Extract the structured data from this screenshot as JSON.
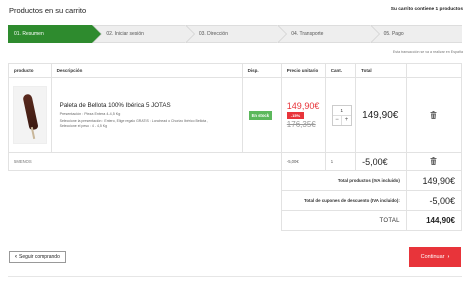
{
  "header": {
    "title": "Productos en su carrito",
    "cart_count": "Su carrito contiene 1 productos"
  },
  "steps": [
    {
      "label": "01. Resumen",
      "active": true
    },
    {
      "label": "02. Iniciar sesión",
      "active": false
    },
    {
      "label": "03. Dirección",
      "active": false
    },
    {
      "label": "04. Transporte",
      "active": false
    },
    {
      "label": "05. Pago",
      "active": false
    }
  ],
  "notice": "Esta transacción se va a realizar en España",
  "table": {
    "headers": {
      "product": "producto",
      "description": "Descripción",
      "availability": "Disp.",
      "unit_price": "Precio unitario",
      "quantity": "Cant.",
      "total": "Total"
    },
    "product": {
      "name": "Paleta de Bellota 100% Ibérica 5 JOTAS",
      "presentation": "Presentación : Pieza Entera 4-4,5 Kg",
      "selection": "Seleccione la presentación : Entero, Elige regalo GRATIS : Lonchead o Chorizo Ibérico Bellota , Seleccione el peso : 4 - 4,5 Kg",
      "stock": "En stock",
      "price": "149,90€",
      "discount": "-15%",
      "old_price": "176,35€",
      "quantity": "1",
      "total": "149,90€",
      "thumb_icon": "ham-product-image"
    },
    "discount_row": {
      "name": "5MENOS",
      "unit": "-5,00€",
      "quantity": "1",
      "total": "-5,00€"
    },
    "summary": {
      "products_label": "Total productos (IVA incluido)",
      "products_value": "149,90€",
      "coupons_label": "Total de cupones de descuento (IVA incluido):",
      "coupons_value": "-5,00€",
      "total_label": "TOTAL",
      "total_value": "144,90€"
    }
  },
  "buttons": {
    "continue_shopping": "Seguir comprando",
    "continue": "Continuar"
  },
  "colors": {
    "active_step": "#2e8b2e",
    "accent_red": "#e8343a",
    "stock_green": "#5cb85c"
  }
}
